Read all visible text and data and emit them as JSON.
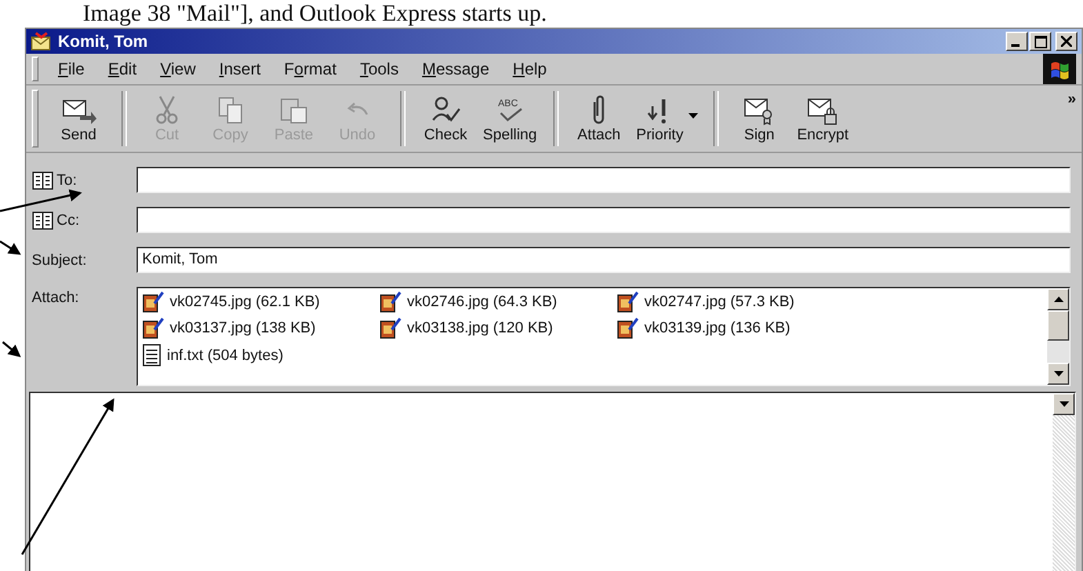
{
  "caption": "Image 38 \"Mail\"], and Outlook Express starts up.",
  "window": {
    "title": "Komit, Tom"
  },
  "menu": [
    {
      "key": "F",
      "post": "ile"
    },
    {
      "key": "E",
      "post": "dit"
    },
    {
      "key": "V",
      "post": "iew"
    },
    {
      "key": "I",
      "post": "nsert"
    },
    {
      "pre": "F",
      "key": "o",
      "post": "rmat"
    },
    {
      "key": "T",
      "post": "ools"
    },
    {
      "key": "M",
      "post": "essage"
    },
    {
      "key": "H",
      "post": "elp"
    }
  ],
  "toolbar": [
    {
      "kind": "button",
      "label": "Send",
      "disabled": false
    },
    {
      "kind": "separator"
    },
    {
      "kind": "button",
      "label": "Cut",
      "disabled": true
    },
    {
      "kind": "button",
      "label": "Copy",
      "disabled": true
    },
    {
      "kind": "button",
      "label": "Paste",
      "disabled": true
    },
    {
      "kind": "button",
      "label": "Undo",
      "disabled": true
    },
    {
      "kind": "separator"
    },
    {
      "kind": "button",
      "label": "Check",
      "disabled": false
    },
    {
      "kind": "button",
      "label": "Spelling",
      "disabled": false,
      "icon_text": "ABC"
    },
    {
      "kind": "separator"
    },
    {
      "kind": "button",
      "label": "Attach",
      "disabled": false
    },
    {
      "kind": "button",
      "label": "Priority",
      "disabled": false,
      "dropdown": true
    },
    {
      "kind": "separator"
    },
    {
      "kind": "button",
      "label": "Sign",
      "disabled": false
    },
    {
      "kind": "button",
      "label": "Encrypt",
      "disabled": false
    }
  ],
  "toolbar_more": "»",
  "fields": [
    {
      "kind": "address",
      "label": "To:"
    },
    {
      "kind": "address",
      "label": "Cc:"
    },
    {
      "kind": "text",
      "label": "Subject:",
      "value": "Komit, Tom"
    }
  ],
  "attach": {
    "label": "Attach:",
    "files": [
      {
        "kind": "image",
        "name": "vk02745.jpg (62.1 KB)"
      },
      {
        "kind": "image",
        "name": "vk02746.jpg (64.3 KB)"
      },
      {
        "kind": "image",
        "name": "vk02747.jpg (57.3 KB)"
      },
      {
        "kind": "image",
        "name": "vk03137.jpg (138 KB)"
      },
      {
        "kind": "image",
        "name": "vk03138.jpg (120 KB)"
      },
      {
        "kind": "image",
        "name": "vk03139.jpg (136 KB)"
      },
      {
        "kind": "text",
        "name": "inf.txt (504 bytes)"
      }
    ]
  }
}
